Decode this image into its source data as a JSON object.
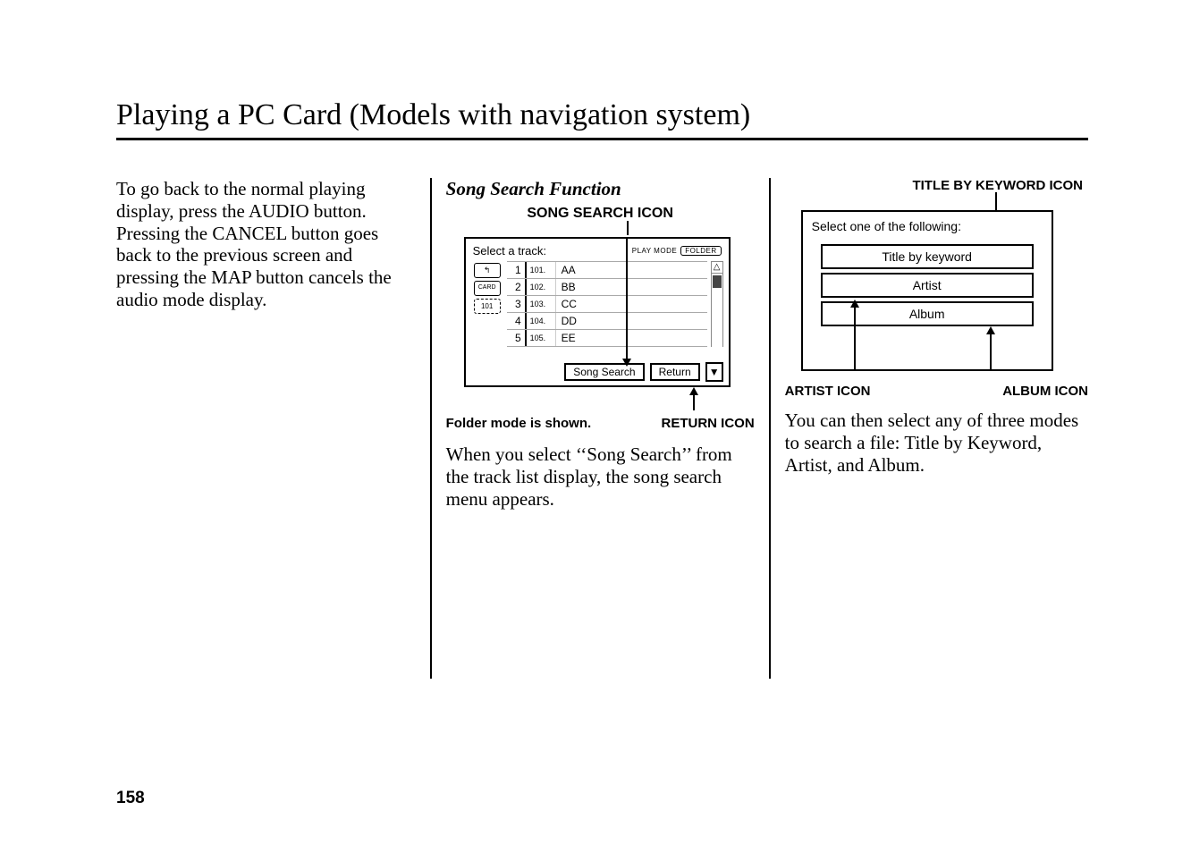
{
  "page": {
    "title": "Playing a PC Card (Models with navigation system)",
    "number": "158"
  },
  "col1": {
    "paragraph": "To go back to the normal playing display, press the AUDIO button. Pressing the CANCEL button goes back to the previous screen and pressing the MAP button cancels the audio mode display."
  },
  "col2": {
    "subheading": "Song Search Function",
    "label_song_search_icon": "SONG SEARCH ICON",
    "label_folder_mode": "Folder mode is shown.",
    "label_return_icon": "RETURN ICON",
    "paragraph": "When you select ‘‘Song Search’’ from the track list display, the song search menu appears.",
    "screen": {
      "prompt": "Select a track:",
      "play_mode_label": "PLAY MODE",
      "play_mode_value": "FOLDER",
      "side_icons": {
        "up": "↰",
        "card": "CARD",
        "folder": "101"
      },
      "tracks": [
        {
          "n": "1",
          "file": "101.",
          "name": "AA"
        },
        {
          "n": "2",
          "file": "102.",
          "name": "BB"
        },
        {
          "n": "3",
          "file": "103.",
          "name": "CC"
        },
        {
          "n": "4",
          "file": "104.",
          "name": "DD"
        },
        {
          "n": "5",
          "file": "105.",
          "name": "EE"
        }
      ],
      "btn_song_search": "Song Search",
      "btn_return": "Return"
    }
  },
  "col3": {
    "label_title_by_keyword": "TITLE BY KEYWORD ICON",
    "label_artist": "ARTIST ICON",
    "label_album": "ALBUM ICON",
    "paragraph": "You can then select any of three modes to search a file: Title by Keyword, Artist, and Album.",
    "screen": {
      "prompt": "Select one of the following:",
      "options": {
        "title_by_keyword": "Title by keyword",
        "artist": "Artist",
        "album": "Album"
      }
    }
  }
}
